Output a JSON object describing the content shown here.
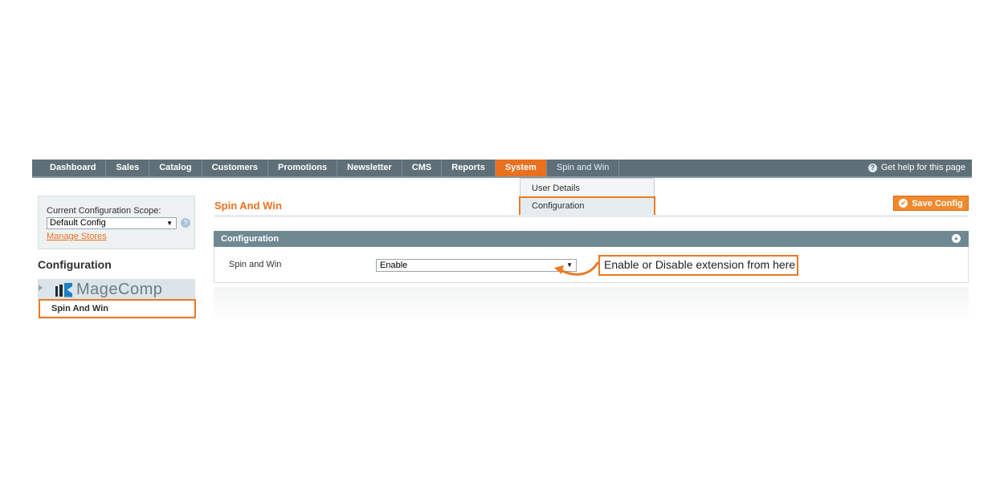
{
  "nav": {
    "items": [
      {
        "label": "Dashboard"
      },
      {
        "label": "Sales"
      },
      {
        "label": "Catalog"
      },
      {
        "label": "Customers"
      },
      {
        "label": "Promotions"
      },
      {
        "label": "Newsletter"
      },
      {
        "label": "CMS"
      },
      {
        "label": "Reports"
      },
      {
        "label": "System",
        "active": true
      },
      {
        "label": "Spin and Win"
      }
    ],
    "help_label": "Get help for this page",
    "help_icon": "help-icon"
  },
  "dropdown": {
    "items": [
      "User Details",
      "Configuration"
    ],
    "highlighted": "Configuration"
  },
  "sidebar": {
    "scope_label": "Current Configuration Scope:",
    "scope_value": "Default Config",
    "manage_stores": "Manage Stores",
    "title": "Configuration",
    "group_logo_text": "MageComp",
    "item": "Spin And Win"
  },
  "main": {
    "page_title": "Spin And Win",
    "save_label": "Save Config",
    "section_title": "Configuration",
    "field_label": "Spin and Win",
    "field_value": "Enable"
  },
  "annotation": {
    "text": "Enable or Disable extension from here"
  },
  "colors": {
    "accent": "#e9701e",
    "nav_bg": "#5e6f78",
    "section_head": "#6f8992",
    "highlight_border": "#ec7a23"
  }
}
